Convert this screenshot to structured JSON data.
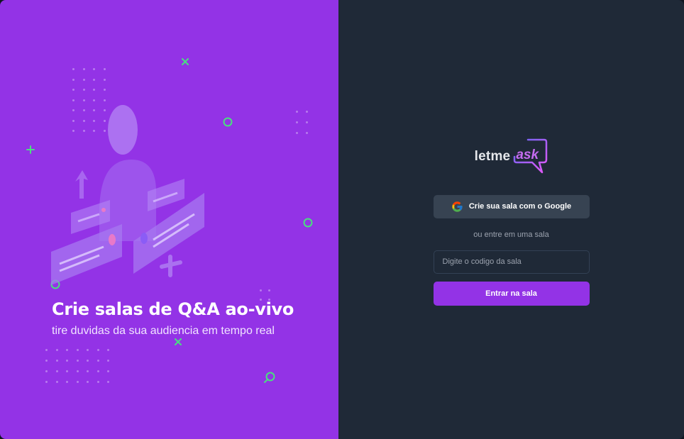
{
  "aside": {
    "title": "Crie salas de Q&A ao-vivo",
    "subtitle": "tire duvidas da sua audiencia em tempo real"
  },
  "logo": {
    "part1": "letme",
    "part2": "ask"
  },
  "auth": {
    "google_button": "Crie sua sala com o Google",
    "separator": "ou entre em uma sala",
    "room_input_placeholder": "Digite o codigo da sala",
    "room_input_value": "",
    "enter_button": "Entrar na sala"
  },
  "icons": {
    "google": "google-icon",
    "logo_bubble": "speech-bubble-icon"
  },
  "colors": {
    "accent": "#9333e6",
    "aside_bg": "#9333e6",
    "main_bg": "#1f2937",
    "google_button_bg": "#374352",
    "deco_green": "#4ade80"
  }
}
